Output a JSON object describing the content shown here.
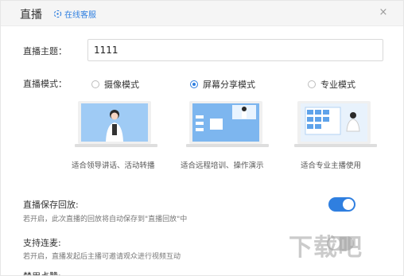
{
  "header": {
    "title": "直播",
    "service_label": "在线客服",
    "close": "×"
  },
  "subject": {
    "label": "直播主题：",
    "value": "1111"
  },
  "mode": {
    "label": "直播模式：",
    "options": [
      {
        "label": "摄像模式",
        "caption": "适合领导讲话、活动转播",
        "selected": false
      },
      {
        "label": "屏幕分享模式",
        "caption": "适合远程培训、操作演示",
        "selected": true
      },
      {
        "label": "专业模式",
        "caption": "适合专业主播使用",
        "selected": false
      }
    ]
  },
  "settings": {
    "save_replay": {
      "title": "直播保存回放:",
      "desc": "若开启，此次直播的回放将自动保存到\"直播回放\"中",
      "enabled": true
    },
    "co_host": {
      "title": "支持连麦:",
      "desc": "若开启，直播发起后主播可邀请观众进行视频互动",
      "enabled": false
    },
    "likes": {
      "title": "禁用点赞:"
    }
  },
  "watermark": "下载吧",
  "colors": {
    "accent": "#2f7fe0",
    "header_bg": "#f5f5f5",
    "toggle_off": "#c8c8c8"
  }
}
